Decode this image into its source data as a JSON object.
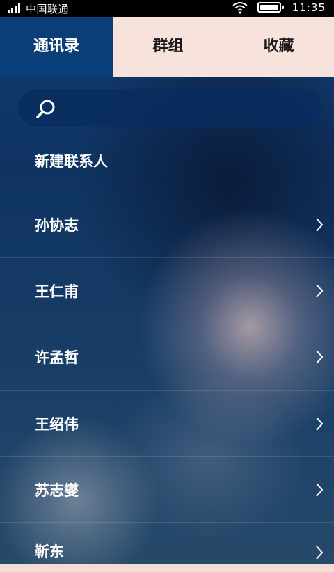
{
  "status_bar": {
    "carrier": "中国联通",
    "time": "11:35"
  },
  "tabs": [
    {
      "label": "通讯录",
      "active": true
    },
    {
      "label": "群组",
      "active": false
    },
    {
      "label": "收藏",
      "active": false
    }
  ],
  "search": {
    "placeholder": "",
    "value": "",
    "icon": "search-icon"
  },
  "new_contact": {
    "label": "新建联系人"
  },
  "contacts": [
    {
      "name": "孙协志"
    },
    {
      "name": "王仁甫"
    },
    {
      "name": "许孟哲"
    },
    {
      "name": "王绍伟"
    },
    {
      "name": "苏志燮"
    },
    {
      "name": "靳东"
    }
  ],
  "colors": {
    "active_tab_bg": "#0a3e78",
    "tab_bar_bg": "#f7e3dc",
    "status_bar_bg": "#000000",
    "text_light": "#ffffff"
  }
}
